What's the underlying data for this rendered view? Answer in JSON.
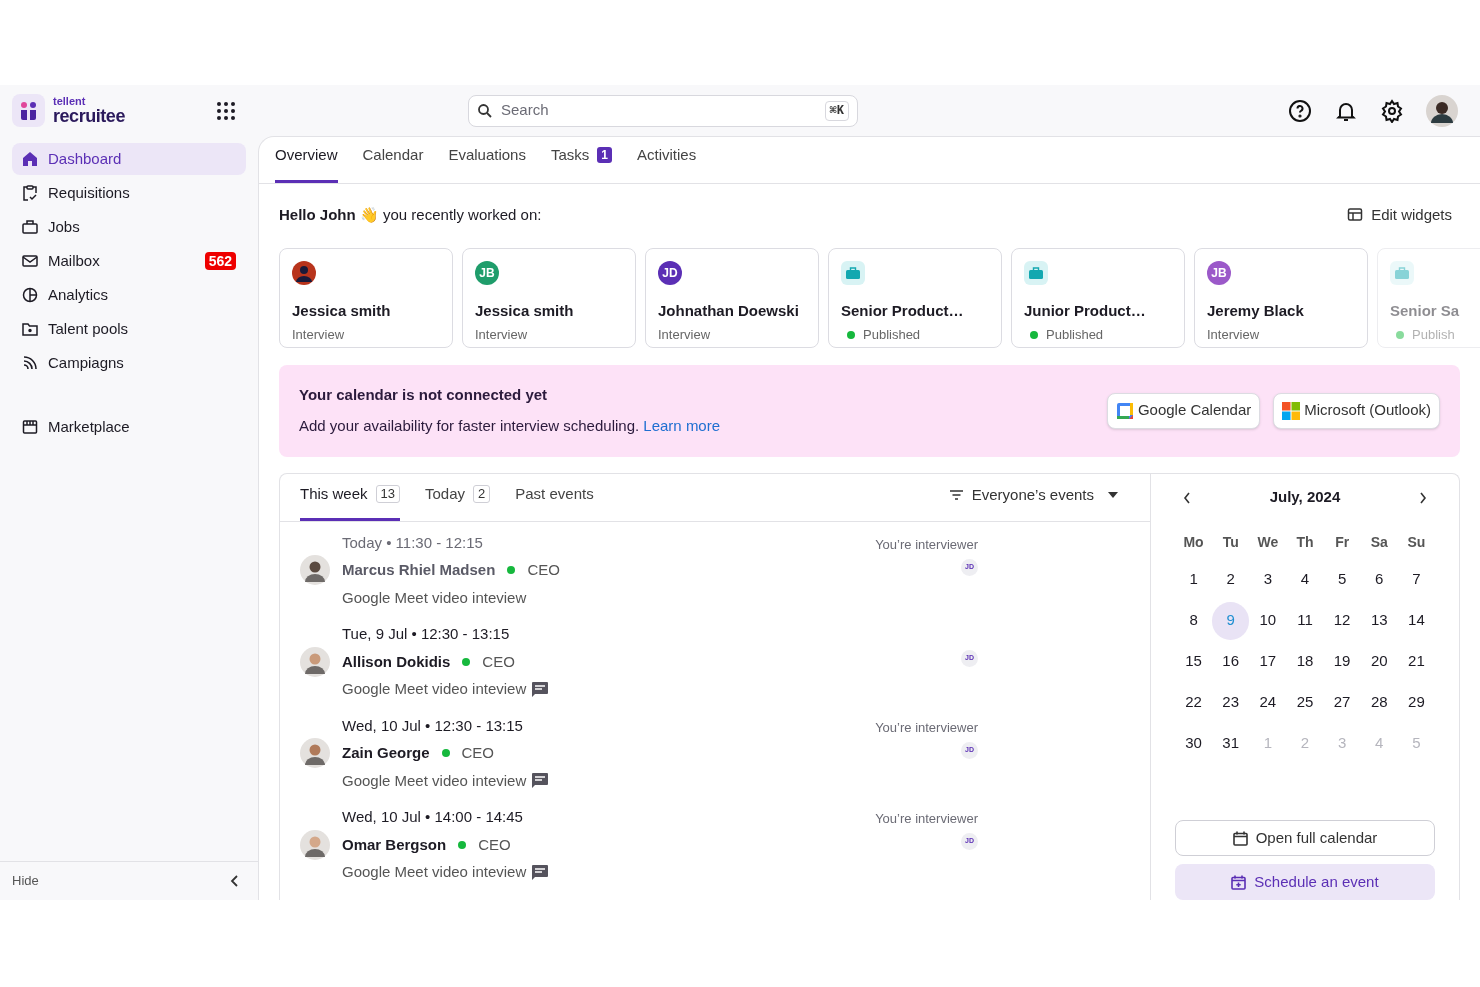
{
  "brand": {
    "top": "tellent",
    "name": "recruitee"
  },
  "search": {
    "placeholder": "Search",
    "shortcut": "⌘K"
  },
  "sidebar": {
    "items": [
      {
        "label": "Dashboard",
        "selected": true
      },
      {
        "label": "Requisitions",
        "selected": false
      },
      {
        "label": "Jobs",
        "selected": false
      },
      {
        "label": "Mailbox",
        "selected": false,
        "badge": "562"
      },
      {
        "label": "Analytics",
        "selected": false
      },
      {
        "label": "Talent pools",
        "selected": false
      },
      {
        "label": "Campiagns",
        "selected": false
      }
    ],
    "extra_items": [
      {
        "label": "Marketplace",
        "selected": false
      }
    ],
    "hide": "Hide"
  },
  "tabs": [
    {
      "label": "Overview",
      "selected": true
    },
    {
      "label": "Calendar",
      "selected": false
    },
    {
      "label": "Evaluations",
      "selected": false
    },
    {
      "label": "Tasks",
      "selected": false,
      "badge": "1"
    },
    {
      "label": "Activities",
      "selected": false
    }
  ],
  "greeting": "**Hello John** 👋 you recently worked on:",
  "edit_widgets": "Edit widgets",
  "recent": [
    {
      "kind": "photo",
      "title": "Jessica smith",
      "subtitle": "Interview"
    },
    {
      "kind": "initials",
      "initials": "JB",
      "color": "#1f9d6b",
      "title": "Jessica smith",
      "subtitle": "Interview"
    },
    {
      "kind": "initials",
      "initials": "JD",
      "color": "#5b2fb5",
      "title": "Johnathan Doewski",
      "subtitle": "Interview"
    },
    {
      "kind": "job",
      "title": "Senior Product…",
      "subtitle": "Published",
      "published": true
    },
    {
      "kind": "job",
      "title": "Junior Product…",
      "subtitle": "Published",
      "published": true
    },
    {
      "kind": "initials",
      "initials": "JB",
      "color": "#9b59c9",
      "title": "Jeremy Black",
      "subtitle": "Interview"
    },
    {
      "kind": "job",
      "title": "Senior Sa",
      "subtitle": "Publish",
      "published": true,
      "faded": true
    }
  ],
  "banner": {
    "title": "Your calendar is not connected yet",
    "text": "Add your availability for faster interview scheduling.",
    "link": "Learn more",
    "buttons": [
      {
        "kind": "google",
        "label": "Google Calendar"
      },
      {
        "kind": "microsoft",
        "label": "Microsoft (Outlook)"
      }
    ]
  },
  "events": {
    "tabs": [
      {
        "label": "This week",
        "count": "13",
        "selected": true
      },
      {
        "label": "Today",
        "count": "2",
        "selected": false
      },
      {
        "label": "Past events",
        "selected": false
      }
    ],
    "filter": "Everyone’s events",
    "items": [
      {
        "past": true,
        "when": "Today • 11:30 - 12:15",
        "name": "Marcus Rhiel Madsen",
        "role": "CEO",
        "description": "Google Meet video inteview",
        "comment": false,
        "note": "You’re interviewer",
        "badge": "JD"
      },
      {
        "past": false,
        "when": "Tue, 9 Jul • 12:30 - 13:15",
        "name": "Allison Dokidis",
        "role": "CEO",
        "description": "Google Meet video inteview",
        "comment": true,
        "badge": "JD"
      },
      {
        "past": false,
        "when": "Wed, 10 Jul • 12:30 - 13:15",
        "name": "Zain George",
        "role": "CEO",
        "description": "Google Meet video inteview",
        "comment": true,
        "note": "You’re interviewer",
        "badge": "JD"
      },
      {
        "past": false,
        "when": "Wed, 10 Jul • 14:00 - 14:45",
        "name": "Omar Bergson",
        "role": "CEO",
        "description": "Google Meet video inteview",
        "comment": true,
        "note": "You’re interviewer",
        "badge": "JD"
      }
    ]
  },
  "calendar": {
    "month": "July, 2024",
    "weekdays": [
      "Mo",
      "Tu",
      "We",
      "Th",
      "Fr",
      "Sa",
      "Su"
    ],
    "days": [
      {
        "label": "1",
        "selected": false,
        "muted": false
      },
      {
        "label": "2",
        "selected": false,
        "muted": false
      },
      {
        "label": "3",
        "selected": false,
        "muted": false
      },
      {
        "label": "4",
        "selected": false,
        "muted": false
      },
      {
        "label": "5",
        "selected": false,
        "muted": false
      },
      {
        "label": "6",
        "selected": false,
        "muted": false
      },
      {
        "label": "7",
        "selected": false,
        "muted": false
      },
      {
        "label": "8",
        "selected": false,
        "muted": false
      },
      {
        "label": "9",
        "selected": true,
        "muted": false
      },
      {
        "label": "10",
        "selected": false,
        "muted": false
      },
      {
        "label": "11",
        "selected": false,
        "muted": false
      },
      {
        "label": "12",
        "selected": false,
        "muted": false
      },
      {
        "label": "13",
        "selected": false,
        "muted": false
      },
      {
        "label": "14",
        "selected": false,
        "muted": false
      },
      {
        "label": "15",
        "selected": false,
        "muted": false
      },
      {
        "label": "16",
        "selected": false,
        "muted": false
      },
      {
        "label": "17",
        "selected": false,
        "muted": false
      },
      {
        "label": "18",
        "selected": false,
        "muted": false
      },
      {
        "label": "19",
        "selected": false,
        "muted": false
      },
      {
        "label": "20",
        "selected": false,
        "muted": false
      },
      {
        "label": "21",
        "selected": false,
        "muted": false
      },
      {
        "label": "22",
        "selected": false,
        "muted": false
      },
      {
        "label": "23",
        "selected": false,
        "muted": false
      },
      {
        "label": "24",
        "selected": false,
        "muted": false
      },
      {
        "label": "25",
        "selected": false,
        "muted": false
      },
      {
        "label": "27",
        "selected": false,
        "muted": false
      },
      {
        "label": "28",
        "selected": false,
        "muted": false
      },
      {
        "label": "29",
        "selected": false,
        "muted": false
      },
      {
        "label": "30",
        "selected": false,
        "muted": false
      },
      {
        "label": "31",
        "selected": false,
        "muted": false
      },
      {
        "label": "1",
        "selected": false,
        "muted": true
      },
      {
        "label": "2",
        "selected": false,
        "muted": true
      },
      {
        "label": "3",
        "selected": false,
        "muted": true
      },
      {
        "label": "4",
        "selected": false,
        "muted": true
      },
      {
        "label": "5",
        "selected": false,
        "muted": true
      }
    ],
    "buttons": [
      {
        "kind": "outline",
        "label": "Open full calendar"
      },
      {
        "kind": "primary",
        "label": "Schedule an event"
      }
    ]
  }
}
